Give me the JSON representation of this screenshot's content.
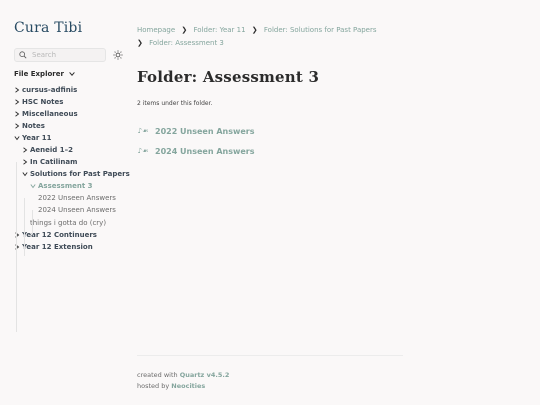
{
  "site": {
    "title": "Cura Tibi"
  },
  "search": {
    "placeholder": "Search"
  },
  "explorer": {
    "title": "File Explorer",
    "folders": [
      "cursus-adfinis",
      "HSC Notes",
      "Miscellaneous",
      "Notes",
      "Year 11",
      "Aeneid 1–2",
      "In Catilinam",
      "Solutions for Past Papers",
      "Assessment 3",
      "Year 12 Continuers",
      "Year 12 Extension"
    ],
    "files": [
      "2022 Unseen Answers",
      "2024 Unseen Answers",
      "things i gotta do (cry)"
    ]
  },
  "breadcrumb": {
    "items": [
      "Homepage",
      "Folder: Year 11",
      "Folder: Solutions for Past Papers",
      "Folder: Assessment 3"
    ],
    "separator": "❯"
  },
  "page": {
    "title": "Folder: Assessment 3",
    "item_count": "2 items under this folder.",
    "items": [
      {
        "label": "2022 Unseen Answers",
        "glyph": "♪☙"
      },
      {
        "label": "2024 Unseen Answers",
        "glyph": "♪☙"
      }
    ]
  },
  "footer": {
    "created_with": "created with",
    "quartz": "Quartz v4.5.2",
    "hosted_by": "hosted by",
    "host": "Neocities"
  },
  "colors": {
    "accent": "#84a59d",
    "title": "#284b63",
    "text": "#2b2b2b",
    "background": "#faf8f8"
  }
}
